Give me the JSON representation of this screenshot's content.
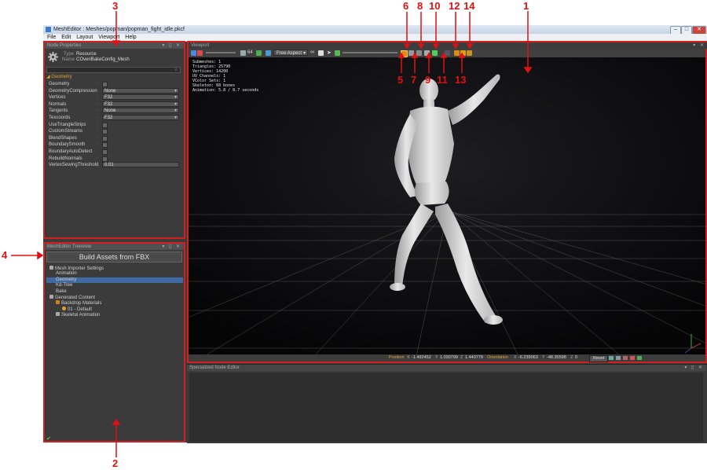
{
  "titlebar": {
    "title": "MeshEditor : Meshes/popman/popman_fight_idle.pkcf"
  },
  "menubar": {
    "items": [
      "File",
      "Edit",
      "Layout",
      "Viewport",
      "Help"
    ]
  },
  "node_properties": {
    "title": "Node Properties",
    "type_label": "Type",
    "type_value": "Resource",
    "name_label": "Name",
    "name_value": "COvenBakeConfig_Mesh",
    "section": "Geometry",
    "rows": [
      {
        "label": "Geometry",
        "kind": "check"
      },
      {
        "label": "GeometryCompression",
        "kind": "dropdown",
        "value": "None"
      },
      {
        "label": "Vertices",
        "kind": "dropdown",
        "value": "F32"
      },
      {
        "label": "Normals",
        "kind": "dropdown",
        "value": "F32"
      },
      {
        "label": "Tangents",
        "kind": "dropdown",
        "value": "None"
      },
      {
        "label": "Texcoords",
        "kind": "dropdown",
        "value": "F32"
      },
      {
        "label": "UseTriangleStrips",
        "kind": "check"
      },
      {
        "label": "CustomStreams",
        "kind": "check"
      },
      {
        "label": "BlendShapes",
        "kind": "check"
      },
      {
        "label": "BoundarySmooth",
        "kind": "check"
      },
      {
        "label": "BoundaryAutoDetect",
        "kind": "check"
      },
      {
        "label": "RebuildNormals",
        "kind": "check"
      },
      {
        "label": "VertexSewingThreshold",
        "kind": "text",
        "value": "0.01"
      }
    ]
  },
  "tree_panel": {
    "title": "MeshEditor Treeview",
    "build_button": "Build Assets from FBX",
    "items": [
      {
        "label": "Mesh Importer Settings",
        "indent": 0,
        "icon": "gear-icon"
      },
      {
        "label": "Animation",
        "indent": 1
      },
      {
        "label": "Geometry",
        "indent": 1,
        "selected": true
      },
      {
        "label": "Kd-Tree",
        "indent": 1
      },
      {
        "label": "Bake",
        "indent": 1
      },
      {
        "label": "Generated Content",
        "indent": 0,
        "icon": "eye-icon"
      },
      {
        "label": "Backdrop Materials",
        "indent": 1,
        "icon": "material-icon"
      },
      {
        "label": "01 - Default",
        "indent": 2,
        "icon": "sphere-icon"
      },
      {
        "label": "Skeletal Animation",
        "indent": 1,
        "icon": "run-icon"
      }
    ]
  },
  "viewport": {
    "title": "Viewport",
    "aspect_dropdown": "Free Aspect",
    "stats": [
      "Submeshes: 1",
      "Triangles: 25790",
      "Vertices: 14200",
      "UV Channels: 1",
      "VColor Sets: 1",
      "Skeleton: 68 bones",
      "Animation: 5.8 / 8.7 seconds"
    ],
    "status": {
      "position_label": "Position",
      "x_label": "X",
      "x": "-1.492452",
      "y_label": "Y",
      "y": "1.030799",
      "z_label": "Z",
      "z": "1.440779",
      "orientation_label": "Orientation",
      "ox_label": "X",
      "ox": "-6.239063",
      "oy_label": "Y",
      "oy": "-48.35598",
      "oz_label": "Z",
      "oz": "0",
      "reset": "Reset"
    }
  },
  "node_editor": {
    "title": "Specialized Node Editor"
  },
  "annotations": [
    "1",
    "2",
    "3",
    "4",
    "5",
    "6",
    "7",
    "8",
    "9",
    "10",
    "11",
    "12",
    "13",
    "14"
  ],
  "colors": {
    "accent_red": "#d02020",
    "selection": "#3f6aa3",
    "toolbar_highlight": "#e08a10"
  }
}
